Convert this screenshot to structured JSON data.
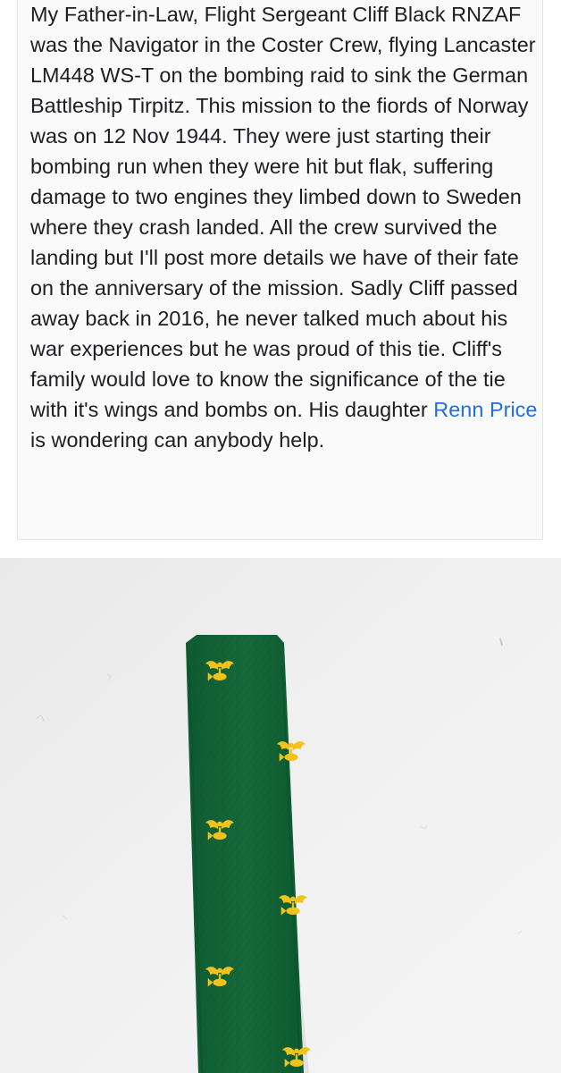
{
  "post": {
    "text_before_mention": "My Father-in-Law, Flight Sergeant Cliff Black RNZAF was the Navigator in the Coster Crew, flying Lancaster LM448 WS-T on the bombing raid to sink the German Battleship Tirpitz. This mission to the fiords of Norway was on 12 Nov 1944. They were just starting their bombing run when they were hit but flak, suffering damage to two engines they limbed down to Sweden where they crash landed. All the crew survived the landing but I'll post more details we have of their fate on the anniversary of the mission. Sadly Cliff passed away back in 2016, he never talked much about his war experiences but he was proud of this tie. Cliff's family would love to know the significance of the tie with it's wings and bombs on. His daughter ",
    "mention": "Renn Price",
    "text_after_mention": " is wondering can anybody help."
  },
  "photo": {
    "subject": "green tie with yellow winged-bomb emblems",
    "colors": {
      "wall": "#eeeeee",
      "tie": "#14663a",
      "emblem": "#f2c21c",
      "mention_link": "#216fdb"
    }
  }
}
